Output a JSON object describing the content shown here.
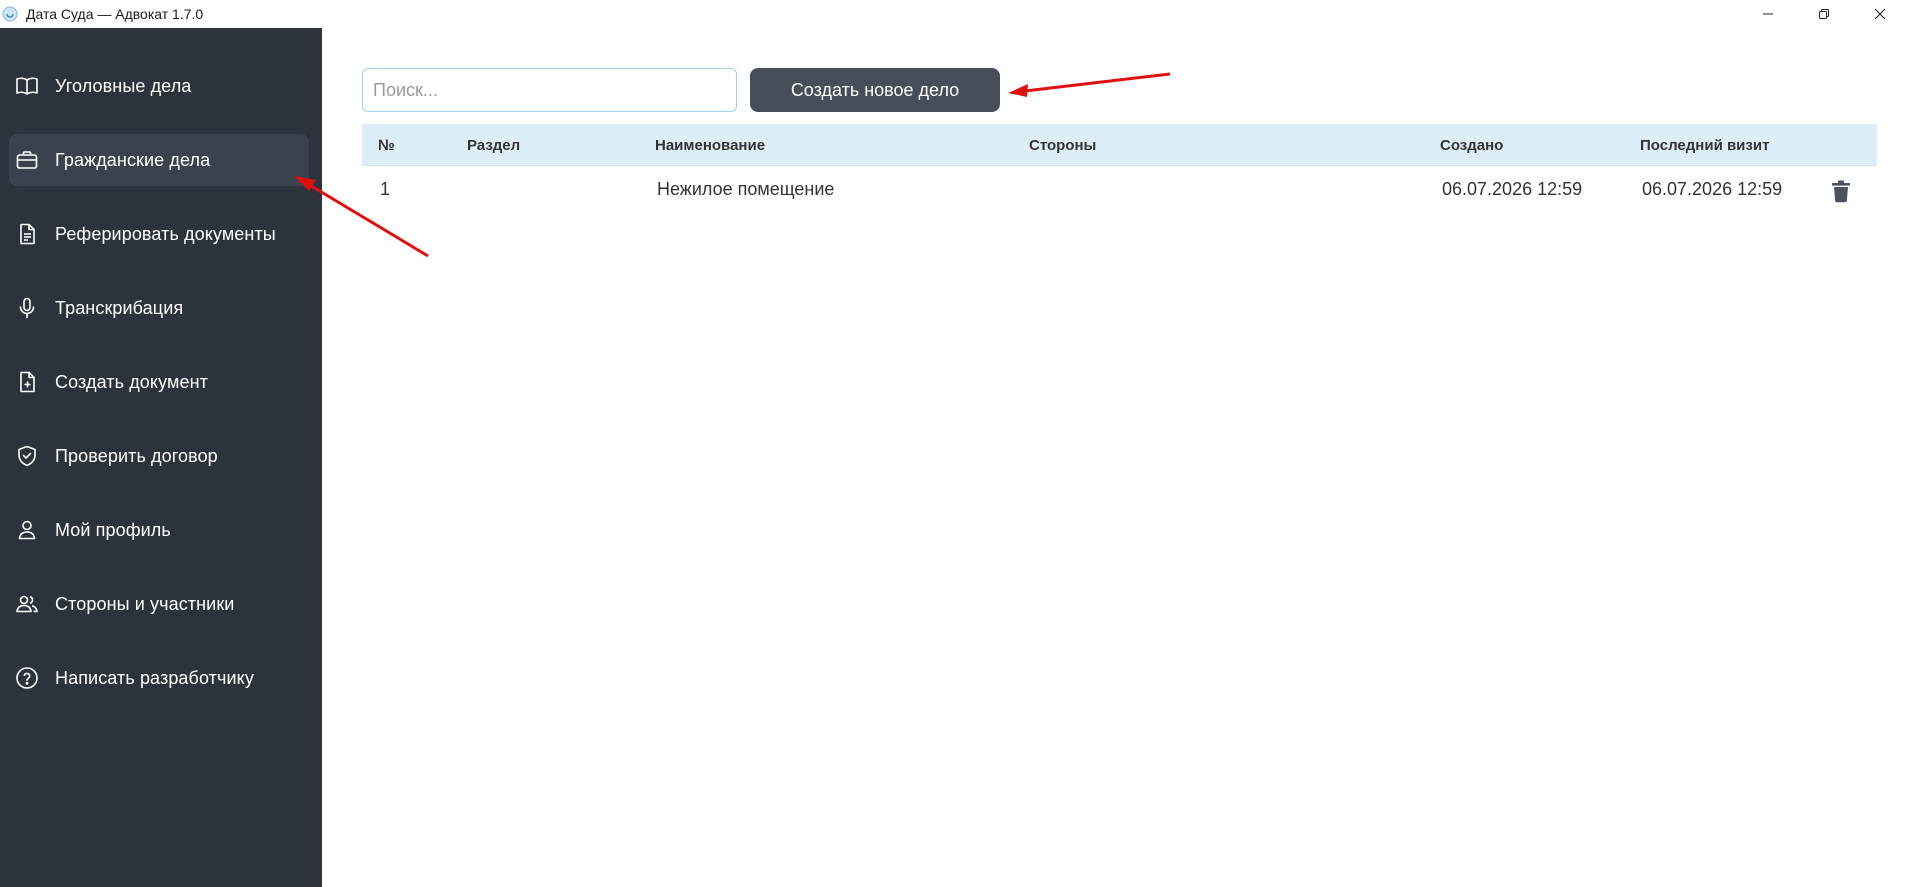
{
  "window": {
    "title": "Дата Суда — Адвокат 1.7.0",
    "controls": [
      "minimize-icon",
      "restore-icon",
      "close-icon"
    ]
  },
  "sidebar": {
    "items": [
      {
        "label": "Уголовные дела",
        "icon": "book-icon",
        "active": false
      },
      {
        "label": "Гражданские дела",
        "icon": "briefcase-icon",
        "active": true
      },
      {
        "label": "Реферировать документы",
        "icon": "document-text-icon",
        "active": false
      },
      {
        "label": "Транскрибация",
        "icon": "microphone-icon",
        "active": false
      },
      {
        "label": "Создать документ",
        "icon": "file-plus-icon",
        "active": false
      },
      {
        "label": "Проверить договор",
        "icon": "shield-check-icon",
        "active": false
      },
      {
        "label": "Мой профиль",
        "icon": "user-icon",
        "active": false
      },
      {
        "label": "Стороны и участники",
        "icon": "users-icon",
        "active": false
      },
      {
        "label": "Написать разработчику",
        "icon": "help-circle-icon",
        "active": false
      }
    ]
  },
  "toolbar": {
    "search_placeholder": "Поиск...",
    "search_value": "",
    "create_label": "Создать новое дело"
  },
  "table": {
    "columns": [
      "№",
      "Раздел",
      "Наименование",
      "Стороны",
      "Создано",
      "Последний визит"
    ],
    "rows": [
      {
        "num": "1",
        "section": "",
        "name": "Нежилое помещение",
        "parties": "",
        "created": "06.07.2026 12:59",
        "last_visit": "06.07.2026 12:59"
      }
    ]
  },
  "colors": {
    "sidebar_bg": "#2d333d",
    "sidebar_active": "#3b424d",
    "button_bg": "#474e5a",
    "table_header_bg": "#deeef8",
    "annotation_arrow": "#e01010"
  }
}
